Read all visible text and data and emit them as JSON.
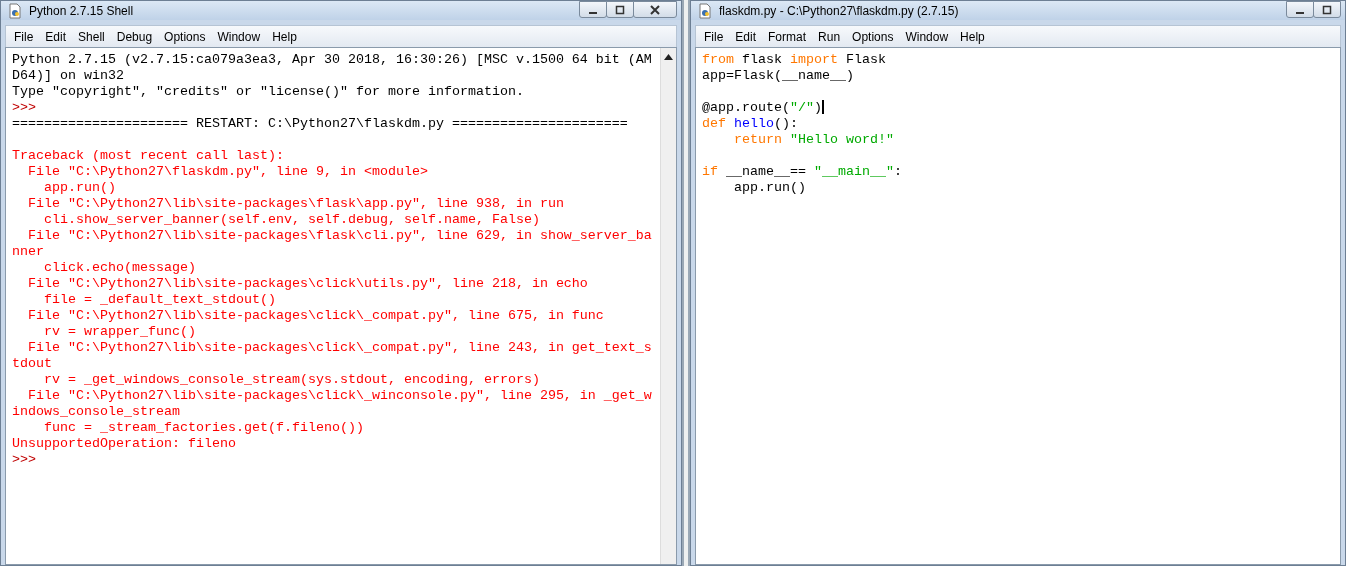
{
  "shell_window": {
    "title": "Python 2.7.15 Shell",
    "menu": [
      "File",
      "Edit",
      "Shell",
      "Debug",
      "Options",
      "Window",
      "Help"
    ],
    "lines": [
      {
        "kind": "output",
        "text": "Python 2.7.15 (v2.7.15:ca079a3ea3, Apr 30 2018, 16:30:26) [MSC v.1500 64 bit (AM"
      },
      {
        "kind": "output",
        "text": "D64)] on win32"
      },
      {
        "kind": "output",
        "text": "Type \"copyright\", \"credits\" or \"license()\" for more information."
      },
      {
        "kind": "prompt",
        "text": ">>>"
      },
      {
        "kind": "output",
        "text": "====================== RESTART: C:\\Python27\\flaskdm.py ======================"
      },
      {
        "kind": "blank"
      },
      {
        "kind": "error",
        "text": "Traceback (most recent call last):"
      },
      {
        "kind": "error",
        "text": "  File \"C:\\Python27\\flaskdm.py\", line 9, in <module>"
      },
      {
        "kind": "error",
        "text": "    app.run()"
      },
      {
        "kind": "error",
        "text": "  File \"C:\\Python27\\lib\\site-packages\\flask\\app.py\", line 938, in run"
      },
      {
        "kind": "error",
        "text": "    cli.show_server_banner(self.env, self.debug, self.name, False)"
      },
      {
        "kind": "error",
        "text": "  File \"C:\\Python27\\lib\\site-packages\\flask\\cli.py\", line 629, in show_server_ba"
      },
      {
        "kind": "error",
        "text": "nner"
      },
      {
        "kind": "error",
        "text": "    click.echo(message)"
      },
      {
        "kind": "error",
        "text": "  File \"C:\\Python27\\lib\\site-packages\\click\\utils.py\", line 218, in echo"
      },
      {
        "kind": "error",
        "text": "    file = _default_text_stdout()"
      },
      {
        "kind": "error",
        "text": "  File \"C:\\Python27\\lib\\site-packages\\click\\_compat.py\", line 675, in func"
      },
      {
        "kind": "error",
        "text": "    rv = wrapper_func()"
      },
      {
        "kind": "error",
        "text": "  File \"C:\\Python27\\lib\\site-packages\\click\\_compat.py\", line 243, in get_text_s"
      },
      {
        "kind": "error",
        "text": "tdout"
      },
      {
        "kind": "error",
        "text": "    rv = _get_windows_console_stream(sys.stdout, encoding, errors)"
      },
      {
        "kind": "error",
        "text": "  File \"C:\\Python27\\lib\\site-packages\\click\\_winconsole.py\", line 295, in _get_w"
      },
      {
        "kind": "error",
        "text": "indows_console_stream"
      },
      {
        "kind": "error",
        "text": "    func = _stream_factories.get(f.fileno())"
      },
      {
        "kind": "error",
        "text": "UnsupportedOperation: fileno"
      },
      {
        "kind": "prompt",
        "text": ">>>"
      }
    ]
  },
  "editor_window": {
    "title": "flaskdm.py - C:\\Python27\\flaskdm.py (2.7.15)",
    "menu": [
      "File",
      "Edit",
      "Format",
      "Run",
      "Options",
      "Window",
      "Help"
    ],
    "code": [
      {
        "kind": "code",
        "indented": false,
        "segments": [
          {
            "kind": "keyword",
            "text": "from"
          },
          {
            "kind": "plain",
            "text": " flask "
          },
          {
            "kind": "keyword",
            "text": "import"
          },
          {
            "kind": "plain",
            "text": " Flask"
          }
        ]
      },
      {
        "kind": "code",
        "indented": false,
        "segments": [
          {
            "kind": "plain",
            "text": "app=Flask(__name__)"
          }
        ]
      },
      {
        "kind": "blank"
      },
      {
        "kind": "code",
        "indented": false,
        "segments": [
          {
            "kind": "plain",
            "text": "@app.route("
          },
          {
            "kind": "string",
            "text": "\"/\""
          },
          {
            "kind": "plain",
            "text": ")"
          },
          {
            "kind": "cursor"
          }
        ]
      },
      {
        "kind": "code",
        "indented": false,
        "segments": [
          {
            "kind": "keyword",
            "text": "def"
          },
          {
            "kind": "definition",
            "text": " hello"
          },
          {
            "kind": "plain",
            "text": "():"
          }
        ]
      },
      {
        "kind": "code",
        "indented": true,
        "segments": [
          {
            "kind": "keyword",
            "text": "return"
          },
          {
            "kind": "string",
            "text": " \"Hello word!\""
          }
        ]
      },
      {
        "kind": "blank"
      },
      {
        "kind": "code",
        "indented": false,
        "segments": [
          {
            "kind": "keyword",
            "text": "if"
          },
          {
            "kind": "plain",
            "text": " __name__== "
          },
          {
            "kind": "string",
            "text": "\"__main__\""
          },
          {
            "kind": "plain",
            "text": ":"
          }
        ]
      },
      {
        "kind": "code",
        "indented": true,
        "segments": [
          {
            "kind": "plain",
            "text": "app.run()"
          }
        ]
      }
    ]
  }
}
